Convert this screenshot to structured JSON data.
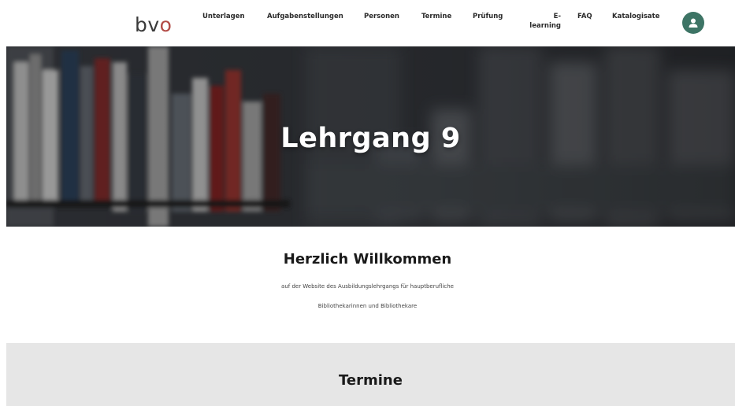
{
  "header": {
    "logo_bv": "bv",
    "logo_o": "o",
    "nav": {
      "unterlagen": "Unterlagen",
      "aufgabenstellungen": "Aufgabenstellungen",
      "personen": "Personen",
      "termine": "Termine",
      "pruefung": "Prüfung",
      "elearning_1": "E-",
      "elearning_2": "learning",
      "faq": "FAQ",
      "katalogisate": "Katalogisate"
    },
    "avatar_icon": "user-icon",
    "avatar_color": "#3d7465"
  },
  "hero": {
    "title": "Lehrgang 9",
    "background": "blurred-bookshelf-image"
  },
  "welcome": {
    "title": "Herzlich Willkommen",
    "line1": "auf der Website des Ausbildungslehrgangs für hauptberufliche",
    "line2": "Bibliothekarinnen und Bibliothekare"
  },
  "termine": {
    "title": "Termine"
  },
  "colors": {
    "accent": "#b24a45",
    "avatar": "#3d7465",
    "section_gray": "#e6e6e6"
  }
}
